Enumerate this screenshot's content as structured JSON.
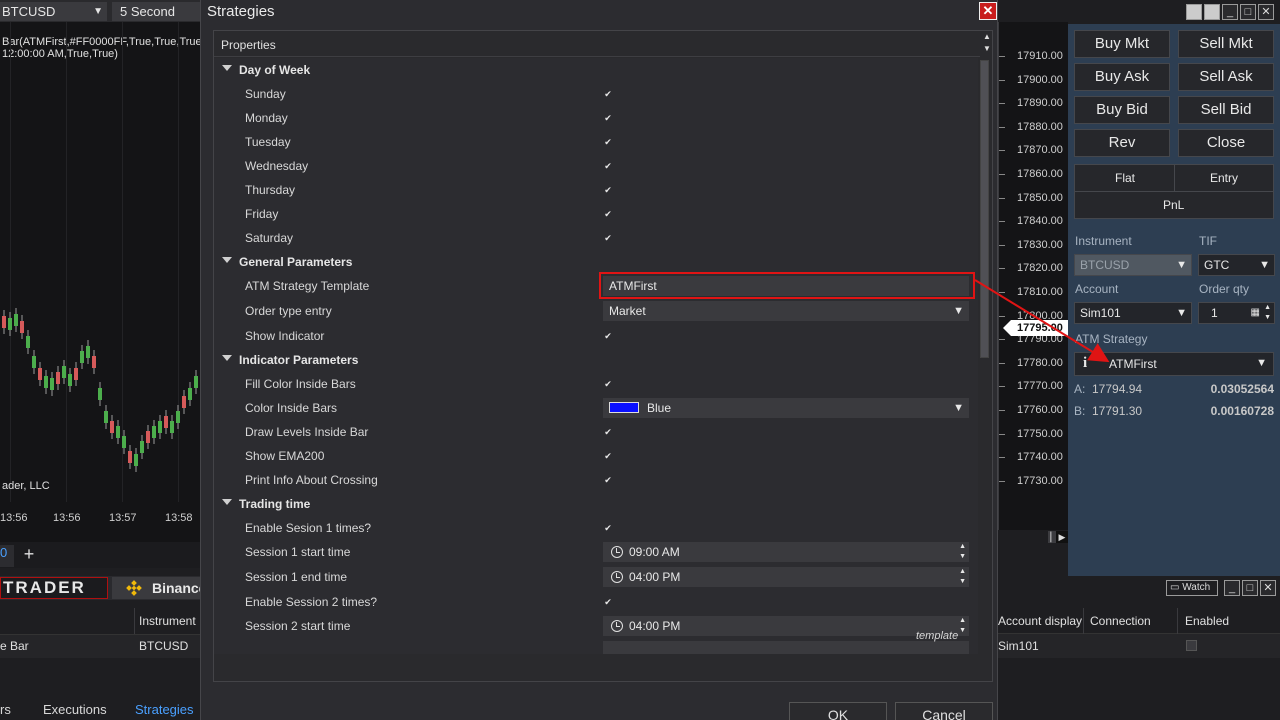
{
  "chart": {
    "instrument": "BTCUSD",
    "period": "5 Second",
    "indicator_line1": "Bar(ATMFirst,#FF0000FF,True,True,True,T",
    "indicator_line2": "12:00:00 AM,True,True)",
    "copyright": "ader, LLC",
    "times": [
      "13:56",
      "13:56",
      "13:57",
      "13:58"
    ],
    "tab_active": "0",
    "tab_add": "+"
  },
  "brand": {
    "trader": "TRADER",
    "binance": "Binance"
  },
  "grid": {
    "header_instrument": "Instrument",
    "row_name": "e Bar",
    "row_instrument": "BTCUSD"
  },
  "bottom_tabs": [
    "rs",
    "Executions",
    "Strategies"
  ],
  "dialog": {
    "title": "Strategies",
    "properties_header": "Properties",
    "template_link": "template",
    "ok": "OK",
    "cancel": "Cancel",
    "sections": [
      {
        "name": "Day of Week",
        "props": [
          {
            "label": "Sunday",
            "type": "check",
            "checked": true
          },
          {
            "label": "Monday",
            "type": "check",
            "checked": true
          },
          {
            "label": "Tuesday",
            "type": "check",
            "checked": true
          },
          {
            "label": "Wednesday",
            "type": "check",
            "checked": true
          },
          {
            "label": "Thursday",
            "type": "check",
            "checked": true
          },
          {
            "label": "Friday",
            "type": "check",
            "checked": true
          },
          {
            "label": "Saturday",
            "type": "check",
            "checked": true
          }
        ]
      },
      {
        "name": "General Parameters",
        "props": [
          {
            "label": "ATM Strategy Template",
            "type": "text",
            "value": "ATMFirst",
            "highlighted": true
          },
          {
            "label": "Order type entry",
            "type": "select",
            "value": "Market"
          },
          {
            "label": "Show Indicator",
            "type": "check",
            "checked": true
          }
        ]
      },
      {
        "name": "Indicator Parameters",
        "props": [
          {
            "label": "Fill Color Inside Bars",
            "type": "check",
            "checked": true
          },
          {
            "label": "Color Inside Bars",
            "type": "color",
            "value": "Blue",
            "color": "#0a10ff"
          },
          {
            "label": "Draw Levels Inside Bar",
            "type": "check",
            "checked": true
          },
          {
            "label": "Show EMA200",
            "type": "check",
            "checked": true
          },
          {
            "label": "Print Info About Crossing",
            "type": "check",
            "checked": true
          }
        ]
      },
      {
        "name": "Trading time",
        "props": [
          {
            "label": "Enable Sesion 1 times?",
            "type": "check",
            "checked": true
          },
          {
            "label": "Session 1 start time",
            "type": "time",
            "value": "09:00 AM"
          },
          {
            "label": "Session 1 end time",
            "type": "time",
            "value": "04:00 PM"
          },
          {
            "label": "Enable Session 2 times?",
            "type": "check",
            "checked": true
          },
          {
            "label": "Session 2 start time",
            "type": "time",
            "value": "04:00 PM"
          }
        ]
      }
    ]
  },
  "price_axis": {
    "labels": [
      "17910.00",
      "17900.00",
      "17890.00",
      "17880.00",
      "17870.00",
      "17860.00",
      "17850.00",
      "17840.00",
      "17830.00",
      "17820.00",
      "17810.00",
      "17800.00",
      "17790.00",
      "17780.00",
      "17770.00",
      "17760.00",
      "17750.00",
      "17740.00",
      "17730.00"
    ],
    "current": "17795.00"
  },
  "order_panel": {
    "buy_mkt": "Buy Mkt",
    "sell_mkt": "Sell Mkt",
    "buy_ask": "Buy Ask",
    "sell_ask": "Sell Ask",
    "buy_bid": "Buy Bid",
    "sell_bid": "Sell Bid",
    "rev": "Rev",
    "close": "Close",
    "flat": "Flat",
    "entry": "Entry",
    "pnl": "PnL",
    "instrument_label": "Instrument",
    "tif_label": "TIF",
    "instrument": "BTCUSD",
    "tif": "GTC",
    "account_label": "Account",
    "order_qty_label": "Order qty",
    "account": "Sim101",
    "order_qty": "1",
    "atm_label": "ATM Strategy",
    "atm_value": "ATMFirst",
    "ask_label": "A:",
    "ask_price": "17794.94",
    "ask_size": "0.03052564",
    "bid_label": "B:",
    "bid_price": "17791.30",
    "bid_size": "0.00160728"
  },
  "right_bottom": {
    "watch": "Watch",
    "headers": [
      "Account display",
      "Connection",
      "Enabled"
    ],
    "row_account": "Sim101"
  },
  "colors": {
    "accent_red": "#e01414",
    "panel_blue": "#2d3e52",
    "dialog_bg": "#2c2c30"
  }
}
